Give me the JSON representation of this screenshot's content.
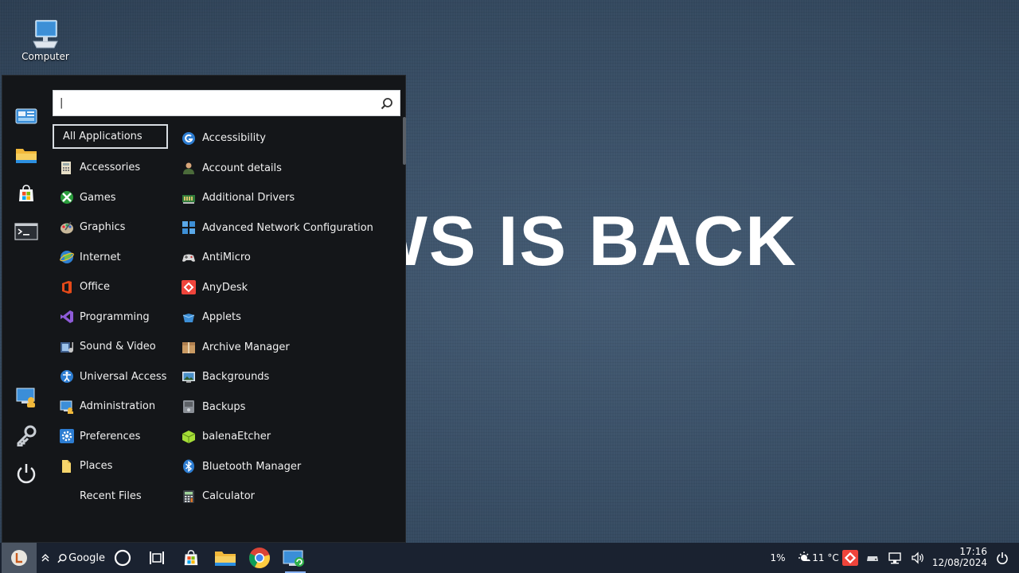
{
  "desktop": {
    "icons": [
      {
        "label": "Computer",
        "icon": "computer-icon"
      }
    ],
    "banner_text": "LINDOWS IS BACK"
  },
  "menu": {
    "search": {
      "value": "",
      "placeholder": ""
    },
    "side_buttons": [
      "control-panel-icon",
      "file-manager-icon",
      "software-store-icon",
      "terminal-icon",
      "user-settings-icon",
      "keys-icon",
      "power-icon"
    ],
    "categories": [
      {
        "label": "All Applications",
        "icon": "",
        "selected": true
      },
      {
        "label": "Accessories",
        "icon": "accessories-icon"
      },
      {
        "label": "Games",
        "icon": "games-icon"
      },
      {
        "label": "Graphics",
        "icon": "graphics-icon"
      },
      {
        "label": "Internet",
        "icon": "internet-icon"
      },
      {
        "label": "Office",
        "icon": "office-icon"
      },
      {
        "label": "Programming",
        "icon": "programming-icon"
      },
      {
        "label": "Sound & Video",
        "icon": "sound-video-icon"
      },
      {
        "label": "Universal Access",
        "icon": "universal-access-icon"
      },
      {
        "label": "Administration",
        "icon": "administration-icon"
      },
      {
        "label": "Preferences",
        "icon": "preferences-icon"
      },
      {
        "label": "Places",
        "icon": "places-icon"
      },
      {
        "label": "Recent Files",
        "icon": ""
      }
    ],
    "apps": [
      {
        "label": "Accessibility",
        "icon": "accessibility-icon"
      },
      {
        "label": "Account details",
        "icon": "account-icon"
      },
      {
        "label": "Additional Drivers",
        "icon": "drivers-icon"
      },
      {
        "label": "Advanced Network Configuration",
        "icon": "network-config-icon"
      },
      {
        "label": "AntiMicro",
        "icon": "gamepad-icon"
      },
      {
        "label": "AnyDesk",
        "icon": "anydesk-icon"
      },
      {
        "label": "Applets",
        "icon": "applets-icon"
      },
      {
        "label": "Archive Manager",
        "icon": "archive-icon"
      },
      {
        "label": "Backgrounds",
        "icon": "backgrounds-icon"
      },
      {
        "label": "Backups",
        "icon": "backups-icon"
      },
      {
        "label": "balenaEtcher",
        "icon": "etcher-icon"
      },
      {
        "label": "Bluetooth Manager",
        "icon": "bluetooth-icon"
      },
      {
        "label": "Calculator",
        "icon": "calculator-icon"
      }
    ]
  },
  "taskbar": {
    "search_label": "Google",
    "tray": {
      "cpu": "1%",
      "weather": "11 °C",
      "time": "17:16",
      "date": "12/08/2024"
    }
  }
}
